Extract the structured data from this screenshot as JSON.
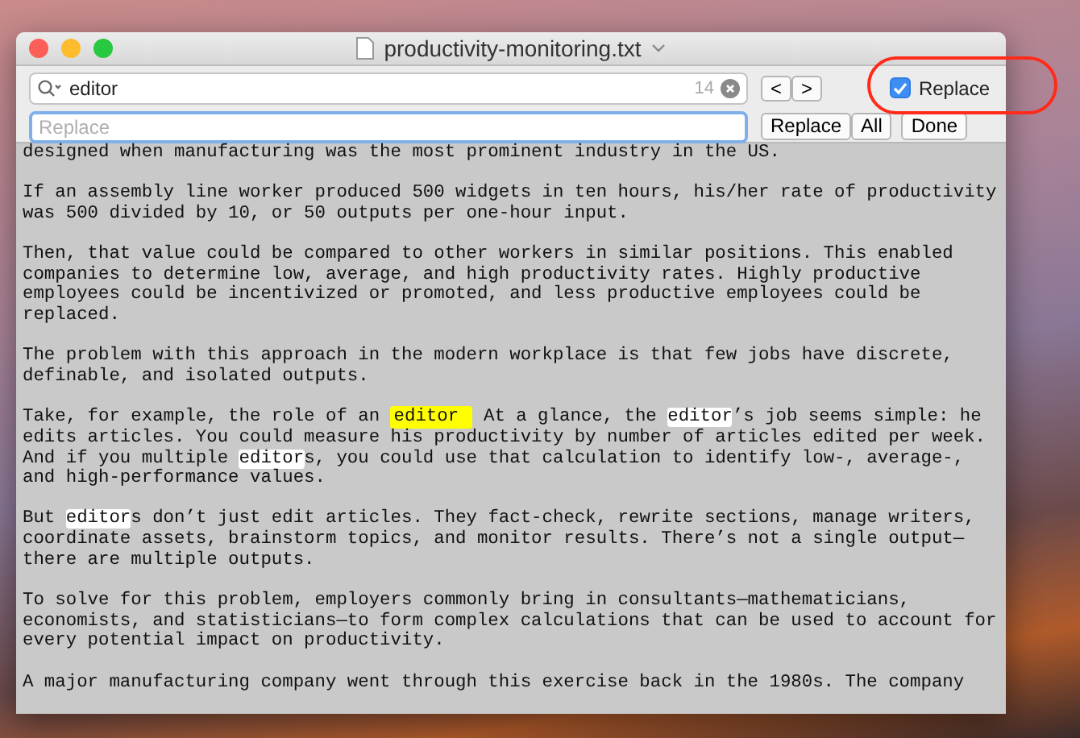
{
  "window": {
    "title": "productivity-monitoring.txt"
  },
  "find_bar": {
    "search": {
      "value": "editor",
      "match_count": "14"
    },
    "nav_buttons": [
      "<",
      ">"
    ],
    "replace_toggle": {
      "label": "Replace",
      "checked": true
    },
    "replace_field": {
      "placeholder": "Replace"
    },
    "buttons": [
      "Replace",
      "All",
      "Done"
    ]
  },
  "document": {
    "paragraphs": [
      [
        [
          {
            "text": "designed when manufacturing was the most prominent industry in the US.",
            "match": false,
            "current": false
          }
        ]
      ],
      [
        [
          {
            "text": "If an assembly line worker produced 500 widgets in ten hours, his/her rate of productivity",
            "match": false,
            "current": false
          }
        ],
        [
          {
            "text": "was 500 divided by 10, or 50 outputs per one-hour input.",
            "match": false,
            "current": false
          }
        ]
      ],
      [
        [
          {
            "text": "Then, that value could be compared to other workers in similar positions. This enabled",
            "match": false,
            "current": false
          }
        ],
        [
          {
            "text": "companies to determine low, average, and high productivity rates. Highly productive",
            "match": false,
            "current": false
          }
        ],
        [
          {
            "text": "employees could be incentivized or promoted, and less productive employees could be",
            "match": false,
            "current": false
          }
        ],
        [
          {
            "text": "replaced.",
            "match": false,
            "current": false
          }
        ]
      ],
      [
        [
          {
            "text": "The problem with this approach in the modern workplace is that few jobs have discrete,",
            "match": false,
            "current": false
          }
        ],
        [
          {
            "text": "definable, and isolated outputs.",
            "match": false,
            "current": false
          }
        ]
      ],
      [
        [
          {
            "text": "Take, for example, the role of an ",
            "match": false,
            "current": false
          },
          {
            "text": "editor ",
            "match": true,
            "current": true
          },
          {
            "text": " At a glance, the ",
            "match": false,
            "current": false
          },
          {
            "text": "editor",
            "match": true,
            "current": false
          },
          {
            "text": "’s job seems simple: he",
            "match": false,
            "current": false
          }
        ],
        [
          {
            "text": "edits articles. You could measure his productivity by number of articles edited per week.",
            "match": false,
            "current": false
          }
        ],
        [
          {
            "text": "And if you multiple ",
            "match": false,
            "current": false
          },
          {
            "text": "editor",
            "match": true,
            "current": false
          },
          {
            "text": "s, you could use that calculation to identify low-, average-,",
            "match": false,
            "current": false
          }
        ],
        [
          {
            "text": "and high-performance values.",
            "match": false,
            "current": false
          }
        ]
      ],
      [
        [
          {
            "text": "But ",
            "match": false,
            "current": false
          },
          {
            "text": "editor",
            "match": true,
            "current": false
          },
          {
            "text": "s don’t just edit articles. They fact-check, rewrite sections, manage writers,",
            "match": false,
            "current": false
          }
        ],
        [
          {
            "text": "coordinate assets, brainstorm topics, and monitor results. There’s not a single output—",
            "match": false,
            "current": false
          }
        ],
        [
          {
            "text": "there are multiple outputs.",
            "match": false,
            "current": false
          }
        ]
      ],
      [
        [
          {
            "text": "To solve for this problem, employers commonly bring in consultants—mathematicians,",
            "match": false,
            "current": false
          }
        ],
        [
          {
            "text": "economists, and statisticians—to form complex calculations that can be used to account for",
            "match": false,
            "current": false
          }
        ],
        [
          {
            "text": "every potential impact on productivity.",
            "match": false,
            "current": false
          }
        ]
      ],
      [
        [
          {
            "text": "A major manufacturing company went through this exercise back in the 1980s. The company",
            "match": false,
            "current": false
          }
        ]
      ]
    ]
  }
}
